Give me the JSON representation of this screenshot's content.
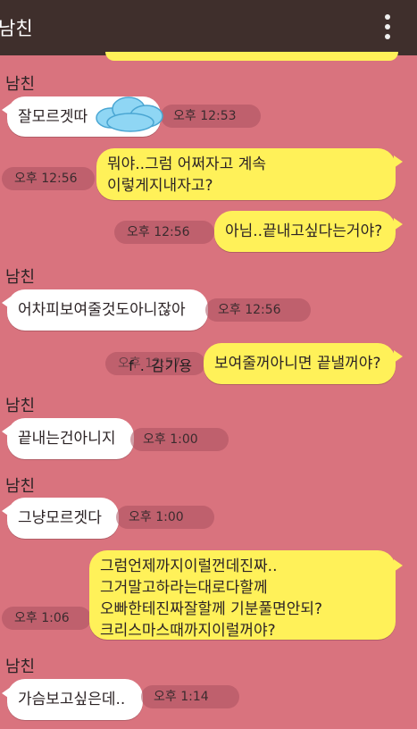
{
  "header": {
    "title": "남친",
    "menu_icon": "more-vertical-icon"
  },
  "contact_name": "남친",
  "messages": [
    {
      "side": "left",
      "text": "잘모르겟따",
      "time": "오후 12:53"
    },
    {
      "side": "right",
      "lines": [
        "뭐야..그럼 어쩌자고 계속",
        "이렇게지내자고?"
      ],
      "time": "오후 12:56"
    },
    {
      "side": "right",
      "text": "아님..끝내고싶다는거야?",
      "time": "오후 12:56"
    },
    {
      "side": "left",
      "text": "어차피보여줄것도아니잖아",
      "time": "오후 12:56"
    },
    {
      "side": "right",
      "text": "보여줄꺼아니면 끝낼꺼야?",
      "time": "오후 12:57"
    },
    {
      "side": "left",
      "text": "끝내는건아니지",
      "time": "오후 1:00"
    },
    {
      "side": "left",
      "text": "그냥모르겟다",
      "time": "오후 1:00"
    },
    {
      "side": "right",
      "lines": [
        "그럼언제까지이럴껀데진짜..",
        "그거말고하라는대로다할께",
        "오빠한테진짜잘할께 기분풀면안되?",
        "크리스마스때까지이럴꺼야?"
      ],
      "time": "오후 1:06"
    },
    {
      "side": "left",
      "text": "가슴보고싶은데..",
      "time": "오후 1:14"
    }
  ],
  "watermark": "f . 김기용",
  "colors": {
    "background": "#d9737e",
    "header": "#3f2f2c",
    "my_bubble": "#fff159",
    "their_bubble": "#ffffff"
  }
}
